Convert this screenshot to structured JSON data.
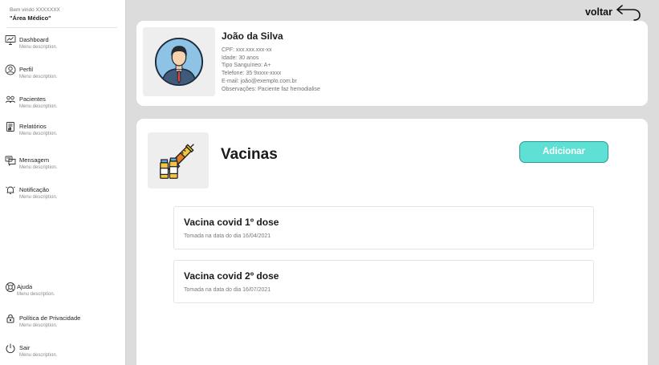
{
  "sidebar": {
    "welcome": "Bem vindo XXXXXXX",
    "area": "\"Área Médico\"",
    "items": [
      {
        "label": "Dashboard",
        "desc": "Menu description.",
        "icon": "dashboard-icon"
      },
      {
        "label": "Perfil",
        "desc": "Menu description.",
        "icon": "user-icon"
      },
      {
        "label": "Pacientes",
        "desc": "Menu description.",
        "icon": "patients-icon"
      },
      {
        "label": "Relatórios",
        "desc": "Menu description.",
        "icon": "report-icon"
      },
      {
        "label": "Mensagem",
        "desc": "Menu description.",
        "icon": "message-icon"
      },
      {
        "label": "Notificação",
        "desc": "Menu description.",
        "icon": "notification-icon"
      }
    ],
    "bottom_items": [
      {
        "label": "Ajuda",
        "desc": "Menu description.",
        "icon": "help-icon"
      },
      {
        "label": "Política de Privacidade",
        "desc": "Menu description.",
        "icon": "lock-icon"
      },
      {
        "label": "Sair",
        "desc": "Menu description.",
        "icon": "power-icon"
      }
    ]
  },
  "header": {
    "back_label": "voltar"
  },
  "patient": {
    "name": "João da Silva",
    "cpf": "CPF: xxx.xxx.xxx-xx",
    "idade": "Idade: 30 anos",
    "tipo": "Tipo Sanguíneo: A+",
    "telefone": "Telefone: 35 9xxxx-xxxx",
    "email": "E-mail: joão@exemplo.com.br",
    "obs": "Observações: Paciente faz hemodialise"
  },
  "vaccines": {
    "title": "Vacinas",
    "add_label": "Adicionar",
    "items": [
      {
        "name": "Vacina covid 1º dose",
        "date": "Tomada na data do dia 16/04/2021"
      },
      {
        "name": "Vacina covid 2º dose",
        "date": "Tomada na data do dia 16/07/2021"
      }
    ]
  },
  "colors": {
    "accent": "#5fe0d4",
    "background": "#dcdcdc",
    "card": "#ffffff"
  }
}
